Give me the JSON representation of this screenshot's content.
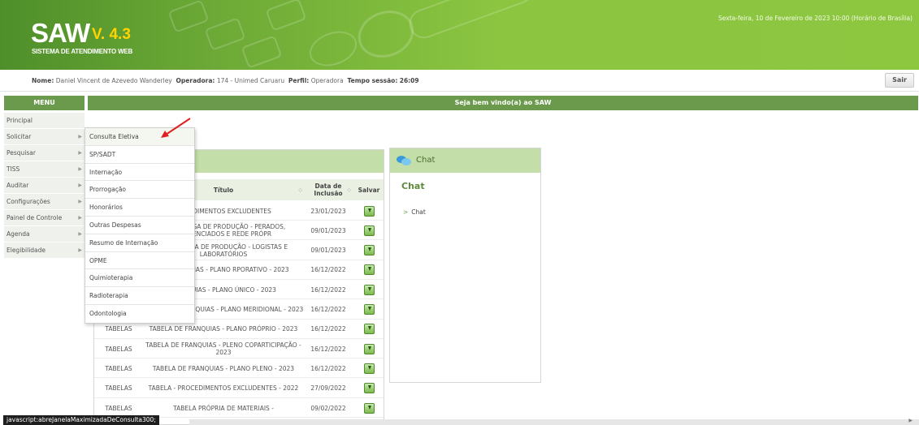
{
  "header": {
    "logo_main": "SAW",
    "logo_version": "V. 4.3",
    "logo_subtitle": "SISTEMA DE ATENDIMENTO WEB",
    "datetime": "Sexta-feira, 10 de Fevereiro de 2023 10:00 (Horário de Brasília)"
  },
  "infobar": {
    "nome_label": "Nome:",
    "nome_value": "Daniel Vincent de Azevedo Wanderley",
    "operadora_label": "Operadora:",
    "operadora_value": "174 - Unimed Caruaru",
    "perfil_label": "Perfil:",
    "perfil_value": "Operadora",
    "sessao_label": "Tempo sessão:",
    "sessao_value": "26:09",
    "sair": "Sair"
  },
  "menu": {
    "title": "MENU",
    "items": [
      "Principal",
      "Solicitar",
      "Pesquisar",
      "TISS",
      "Auditar",
      "Configurações",
      "Painel de Controle",
      "Agenda",
      "Elegibilidade"
    ]
  },
  "welcome": "Seja bem vindo(a) ao SAW",
  "submenu": [
    "Consulta Eletiva",
    "SP/SADT",
    "Internação",
    "Prorrogação",
    "Honorários",
    "Outras Despesas",
    "Resumo de Internação",
    "OPME",
    "Quimioterapia",
    "Radioterapia",
    "Odontologia"
  ],
  "table": {
    "headers": {
      "titulo": "Título",
      "data": "Data de Inclusão",
      "salvar": "Salvar"
    },
    "rows": [
      {
        "tipo": "",
        "titulo": "ROCEDIMENTOS EXCLUDENTES",
        "data": "23/01/2023"
      },
      {
        "tipo": "",
        "titulo": "DE ENTREGA DE PRODUÇÃO - PERADOS, CREDENCIADOS E REDE PRÓPR",
        "data": "09/01/2023"
      },
      {
        "tipo": "",
        "titulo": "DE ENTREGA DE PRODUÇÃO - LOGISTAS E LABORATÓRIOS",
        "data": "09/01/2023"
      },
      {
        "tipo": "",
        "titulo": "DE FRANQUIAS - PLANO RPORATIVO - 2023",
        "data": "16/12/2022"
      },
      {
        "tipo": "",
        "titulo": "FRANQUIAS - PLANO ÚNICO - 2023",
        "data": "16/12/2022"
      },
      {
        "tipo": "TABELAS",
        "titulo": "TABELA DE FRANQUIAS - PLANO MERIDIONAL - 2023",
        "data": "16/12/2022"
      },
      {
        "tipo": "TABELAS",
        "titulo": "TABELA DE FRANQUIAS - PLANO PRÓPRIO - 2023",
        "data": "16/12/2022"
      },
      {
        "tipo": "TABELAS",
        "titulo": "TABELA DE FRANQUIAS - PLENO COPARTICIPAÇÃO - 2023",
        "data": "16/12/2022"
      },
      {
        "tipo": "TABELAS",
        "titulo": "TABELA DE FRANQUIAS - PLANO PLENO - 2023",
        "data": "16/12/2022"
      },
      {
        "tipo": "TABELAS",
        "titulo": "TABELA - PROCEDIMENTOS EXCLUDENTES - 2022",
        "data": "27/09/2022"
      },
      {
        "tipo": "TABELAS",
        "titulo": "TABELA PRÓPRIA DE MATERIAIS -",
        "data": "09/02/2022"
      }
    ]
  },
  "chat": {
    "header": "Chat",
    "title": "Chat",
    "link": "Chat",
    "link_glyph": ">"
  },
  "status_bar": "javascript:abreJanelaMaximizadaDeConsulta300;"
}
